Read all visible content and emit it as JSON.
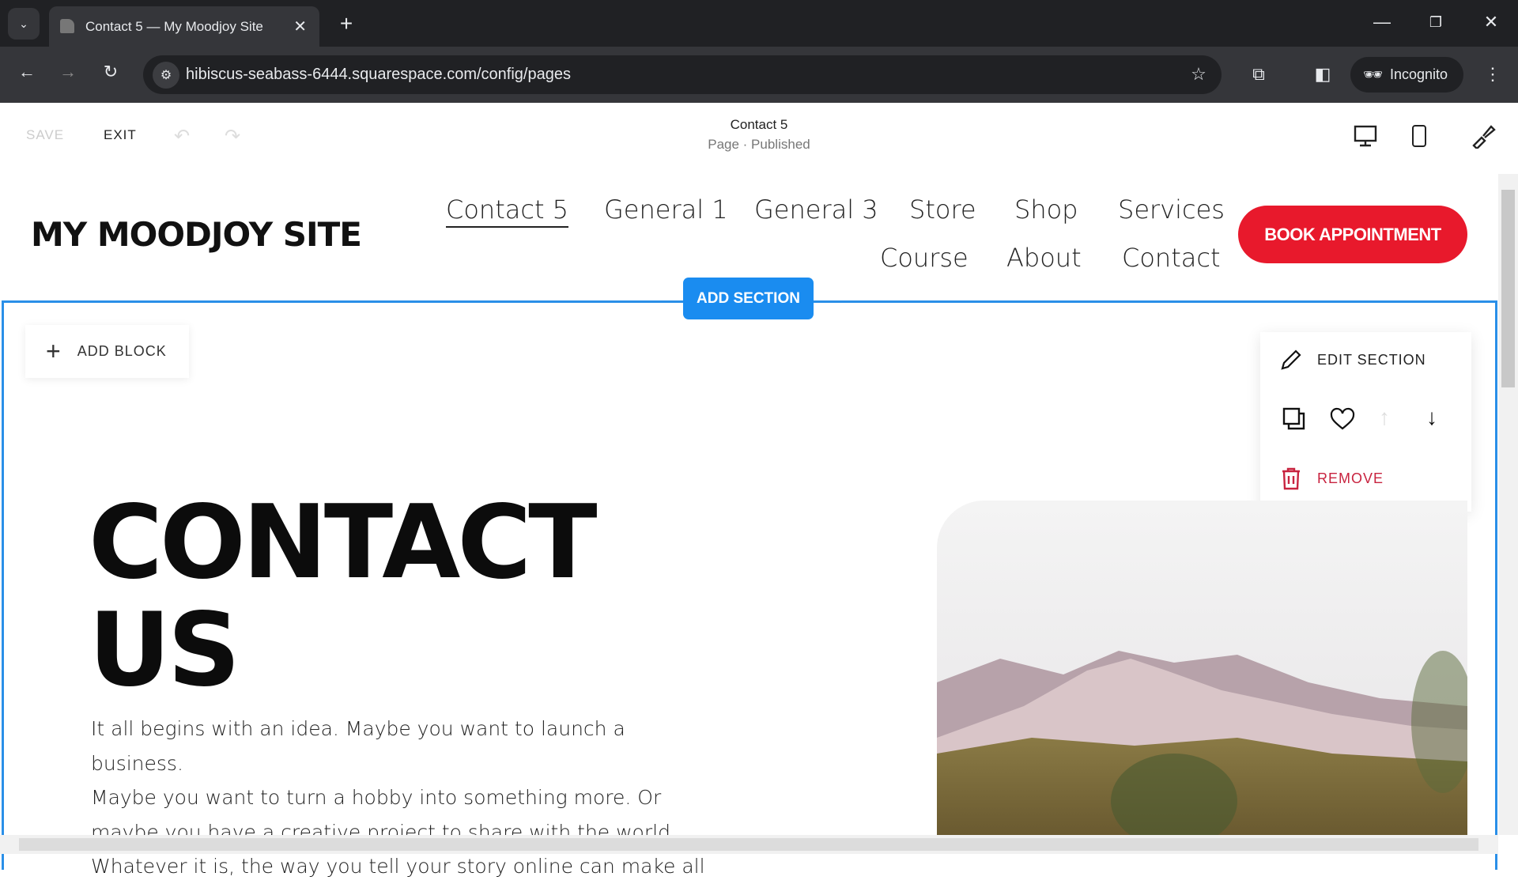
{
  "browser": {
    "tab_title": "Contact 5 — My Moodjoy Site",
    "url": "hibiscus-seabass-6444.squarespace.com/config/pages",
    "incognito_label": "Incognito"
  },
  "editor": {
    "save": "SAVE",
    "exit": "EXIT",
    "page_title": "Contact 5",
    "page_status": "Page · Published"
  },
  "site": {
    "logo": "MY MOODJOY SITE",
    "nav": [
      {
        "label": "Contact 5",
        "active": true
      },
      {
        "label": "General 1"
      },
      {
        "label": "General 3"
      },
      {
        "label": "Store"
      },
      {
        "label": "Shop"
      },
      {
        "label": "Services"
      },
      {
        "label": "Course"
      },
      {
        "label": "About"
      },
      {
        "label": "Contact"
      }
    ],
    "cta": "BOOK APPOINTMENT",
    "accent": "#e8192c"
  },
  "section": {
    "add_section": "ADD SECTION",
    "add_block": "ADD BLOCK",
    "edit_section": "EDIT SECTION",
    "remove": "REMOVE",
    "border_color": "#2a8fe8"
  },
  "content": {
    "heading_line1": "CONTACT",
    "heading_line2": "US",
    "paragraph": [
      "It all begins with an idea. Maybe you want to launch a business.",
      "Maybe you want to turn a hobby into something more. Or",
      "maybe you have a creative project to share with the world.",
      "Whatever it is, the way you tell your story online can make all"
    ]
  }
}
